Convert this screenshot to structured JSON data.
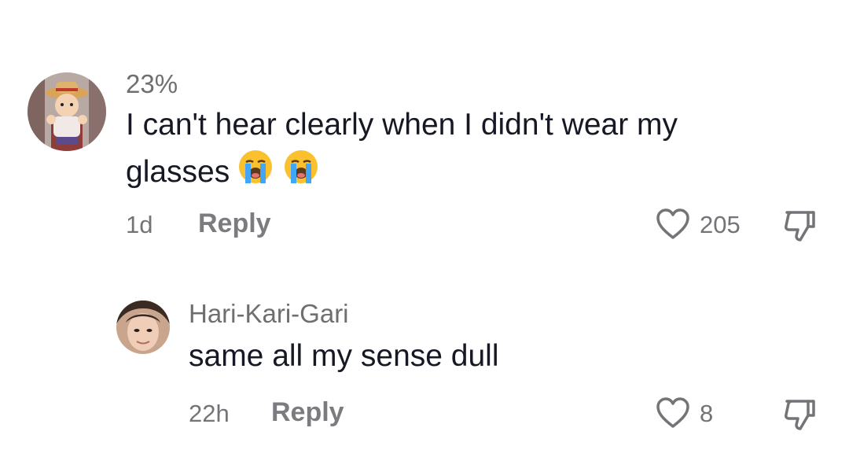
{
  "comments": [
    {
      "username": "23%",
      "text": "I can't hear clearly when I didn't wear my glasses",
      "emojis": [
        "loudly-crying-face",
        "loudly-crying-face"
      ],
      "time": "1d",
      "reply_label": "Reply",
      "like_count": "205",
      "avatar": "cartoon-character-avatar"
    },
    {
      "username": "Hari-Kari-Gari",
      "text": "same all my sense dull",
      "time": "22h",
      "reply_label": "Reply",
      "like_count": "8",
      "avatar": "person-photo-avatar"
    }
  ],
  "icons": {
    "like": "heart-outline-icon",
    "dislike": "thumbs-down-outline-icon"
  },
  "colors": {
    "text": "#161823",
    "secondary": "#747478",
    "emoji_face": "#fbc02d",
    "emoji_tears": "#42a5f5"
  }
}
